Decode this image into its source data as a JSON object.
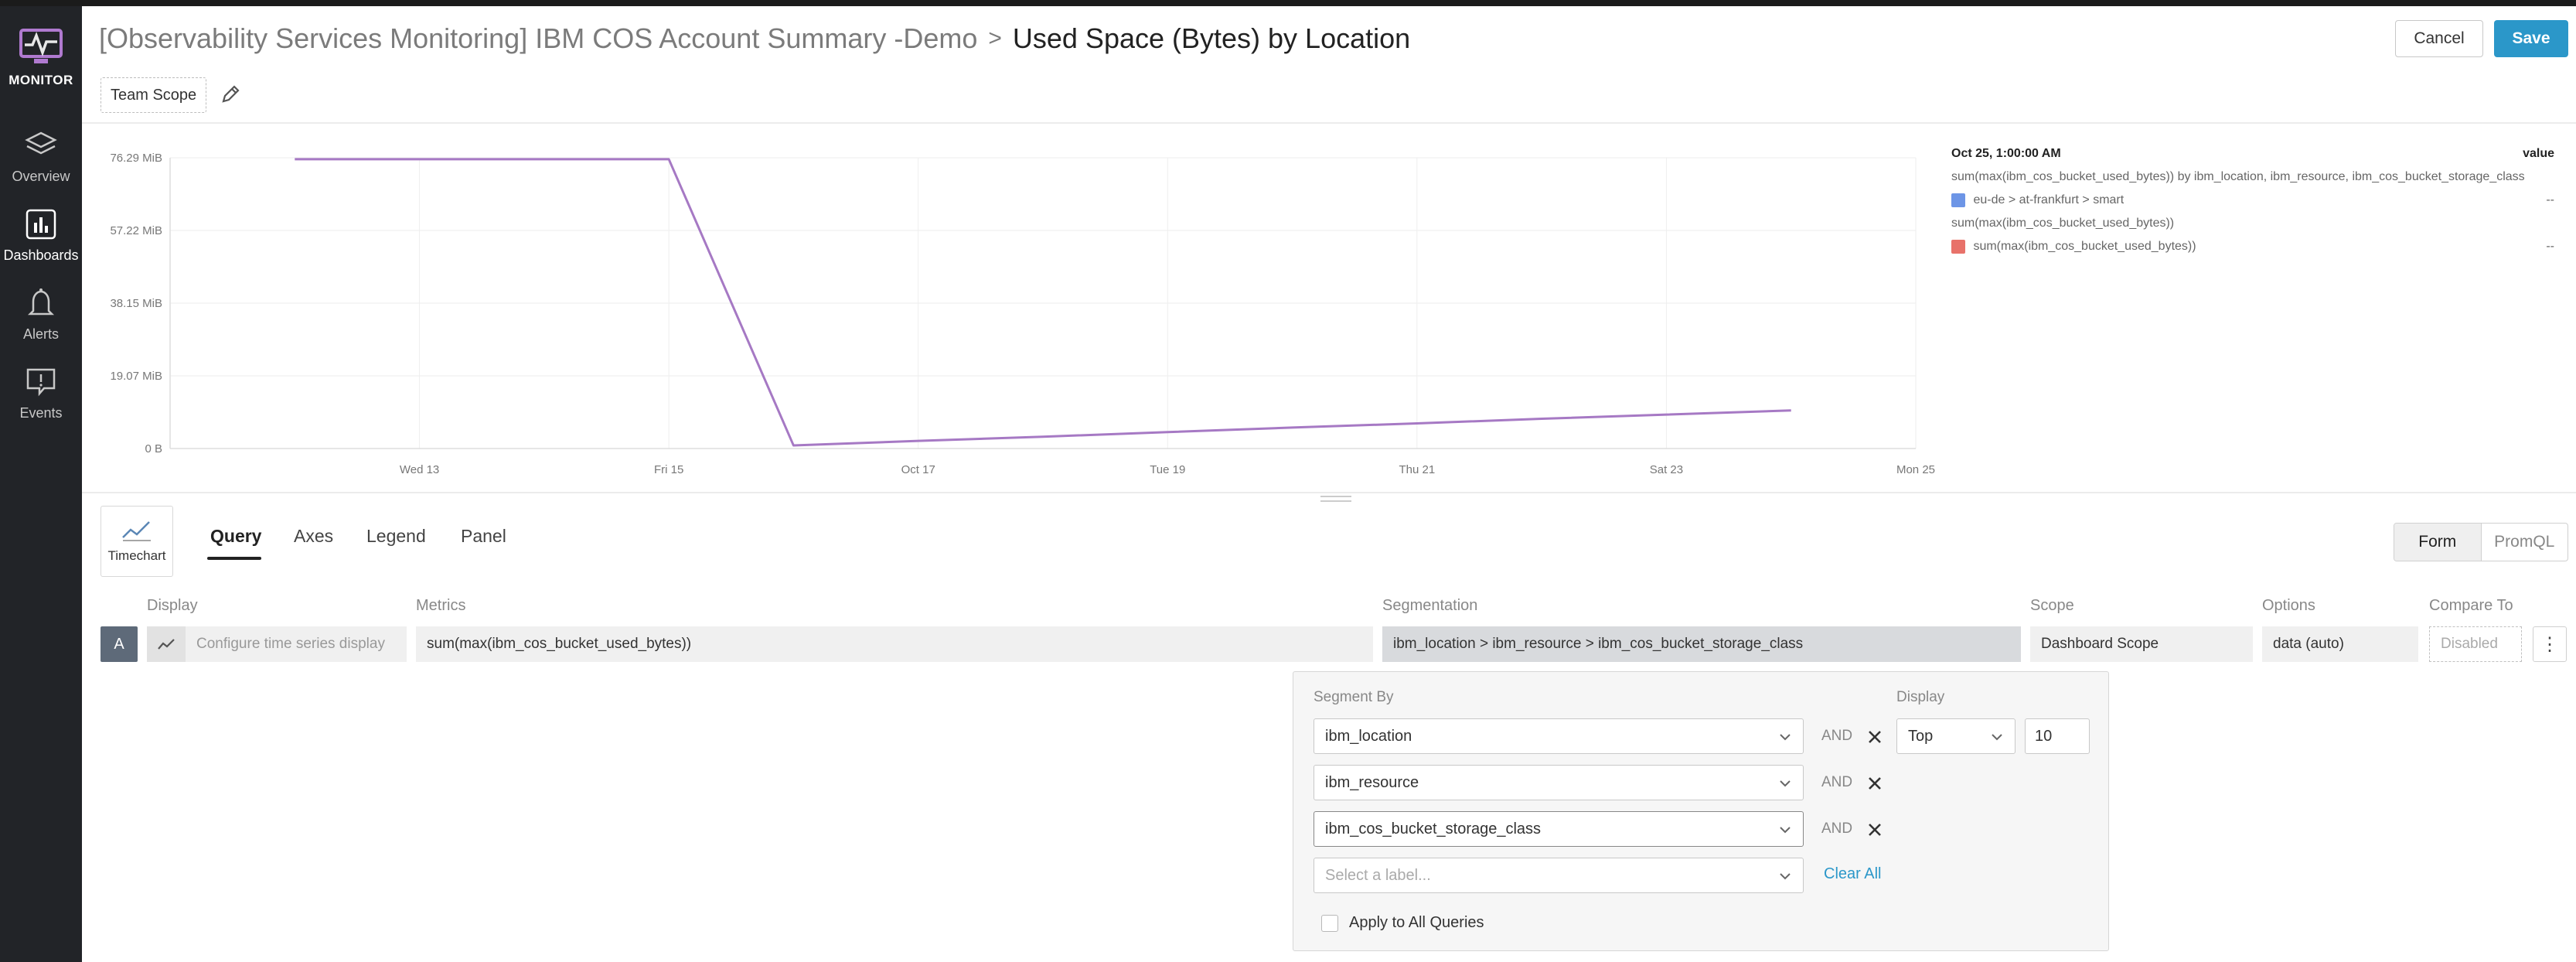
{
  "nav": {
    "brand": "MONITOR",
    "items": [
      {
        "label": "Overview",
        "icon": "layers-icon"
      },
      {
        "label": "Dashboards",
        "icon": "bar-chart-icon"
      },
      {
        "label": "Alerts",
        "icon": "bell-icon"
      },
      {
        "label": "Events",
        "icon": "event-icon"
      }
    ]
  },
  "header": {
    "parent": "[Observability Services Monitoring] IBM COS Account Summary -Demo",
    "separator": ">",
    "current": "Used Space (Bytes) by Location",
    "cancel_label": "Cancel",
    "save_label": "Save",
    "scope_label": "Team Scope"
  },
  "chart_data": {
    "type": "line",
    "x": [
      "Oct 12",
      "Oct 13",
      "Oct 14",
      "Oct 15",
      "Oct 16",
      "Oct 17",
      "Oct 18",
      "Oct 19",
      "Oct 20",
      "Oct 21",
      "Oct 22",
      "Oct 23",
      "Oct 24"
    ],
    "series": [
      {
        "name": "eu-de > at-frankfurt > smart",
        "color": "#a679c4",
        "values": [
          75.9,
          75.9,
          75.9,
          75.9,
          0.8,
          2.0,
          3.1,
          4.3,
          5.5,
          6.6,
          7.8,
          8.9,
          10.0
        ]
      }
    ],
    "ylim": [
      0,
      76.29
    ],
    "y_ticks": [
      "0 B",
      "19.07 MiB",
      "38.15 MiB",
      "57.22 MiB",
      "76.29 MiB"
    ],
    "x_ticks": [
      "Wed 13",
      "Fri 15",
      "Oct 17",
      "Tue 19",
      "Thu 21",
      "Sat 23",
      "Mon 25"
    ],
    "grid": true,
    "legend_position": "right"
  },
  "legend": {
    "time": "Oct 25, 1:00:00 AM",
    "value_header": "value",
    "groups": [
      {
        "query": "sum(max(ibm_cos_bucket_used_bytes)) by ibm_location, ibm_resource, ibm_cos_bucket_storage_class",
        "entry": "eu-de > at-frankfurt > smart",
        "color": "#6d95e6",
        "value": "--"
      },
      {
        "query": "sum(max(ibm_cos_bucket_used_bytes))",
        "entry": "sum(max(ibm_cos_bucket_used_bytes))",
        "color": "#e8726a",
        "value": "--"
      }
    ]
  },
  "editor": {
    "widget_type": "Timechart",
    "tabs": [
      "Query",
      "Axes",
      "Legend",
      "Panel"
    ],
    "modes": [
      "Form",
      "PromQL"
    ],
    "columns": {
      "display": "Display",
      "metrics": "Metrics",
      "segmentation": "Segmentation",
      "scope": "Scope",
      "options": "Options",
      "compare": "Compare To"
    },
    "query": {
      "letter": "A",
      "display_placeholder": "Configure time series display",
      "metric": "sum(max(ibm_cos_bucket_used_bytes))",
      "segmentation": "ibm_location > ibm_resource > ibm_cos_bucket_storage_class",
      "scope": "Dashboard Scope",
      "options": "data (auto)",
      "compare": "Disabled"
    }
  },
  "segment": {
    "label": "Segment By",
    "display_label": "Display",
    "labels": [
      "ibm_location",
      "ibm_resource",
      "ibm_cos_bucket_storage_class"
    ],
    "and": "AND",
    "placeholder": "Select a label...",
    "display_value": "Top",
    "limit": "10",
    "clear_all": "Clear All",
    "apply_all": "Apply to All Queries"
  }
}
